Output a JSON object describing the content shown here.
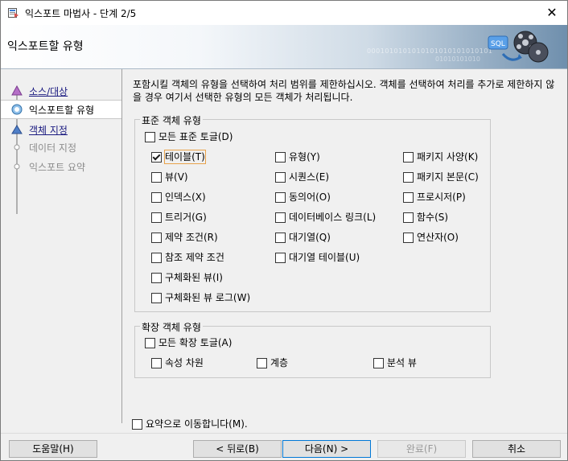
{
  "window": {
    "title": "익스포트 마법사 - 단계 2/5",
    "close_symbol": "✕"
  },
  "banner": {
    "heading": "익스포트할 유형",
    "binary_a": "0001010101010101010101010101",
    "binary_b": "01010101010"
  },
  "nav": {
    "items": [
      {
        "label": "소스/대상",
        "state": "link"
      },
      {
        "label": "익스포트할 유형",
        "state": "active"
      },
      {
        "label": "객체 지정",
        "state": "link"
      },
      {
        "label": "데이터 지정",
        "state": "disabled"
      },
      {
        "label": "익스포트 요약",
        "state": "disabled"
      }
    ]
  },
  "description": "포함시킬 객체의 유형을 선택하여 처리 범위를 제한하십시오. 객체를 선택하여 처리를 추가로 제한하지 않을 경우 여기서 선택한 유형의 모든 객체가 처리됩니다.",
  "standard": {
    "legend": "표준 객체 유형",
    "toggle_all": "모든 표준 토글(D)",
    "col1": [
      "테이블(T)",
      "뷰(V)",
      "인덱스(X)",
      "트리거(G)",
      "제약 조건(R)",
      "참조 제약 조건",
      "구체화된 뷰(I)",
      "구체화된 뷰 로그(W)"
    ],
    "col2": [
      "유형(Y)",
      "시퀀스(E)",
      "동의어(O)",
      "데이터베이스 링크(L)",
      "대기열(Q)",
      "대기열 테이블(U)"
    ],
    "col3": [
      "패키지 사양(K)",
      "패키지 본문(C)",
      "프로시저(P)",
      "함수(S)",
      "연산자(O)"
    ]
  },
  "extended": {
    "legend": "확장 객체 유형",
    "toggle_all": "모든 확장 토글(A)",
    "items": [
      "속성 차원",
      "계층",
      "분석 뷰"
    ]
  },
  "go_to_summary": "요약으로 이동합니다(M).",
  "buttons": {
    "help": "도움말(H)",
    "back": "< 뒤로(B)",
    "next": "다음(N) >",
    "finish": "완료(F)",
    "cancel": "취소"
  },
  "colors": {
    "focus_outline": "#e8a24a",
    "default_button_border": "#0078d7",
    "nav_link": "#1a1a80"
  }
}
